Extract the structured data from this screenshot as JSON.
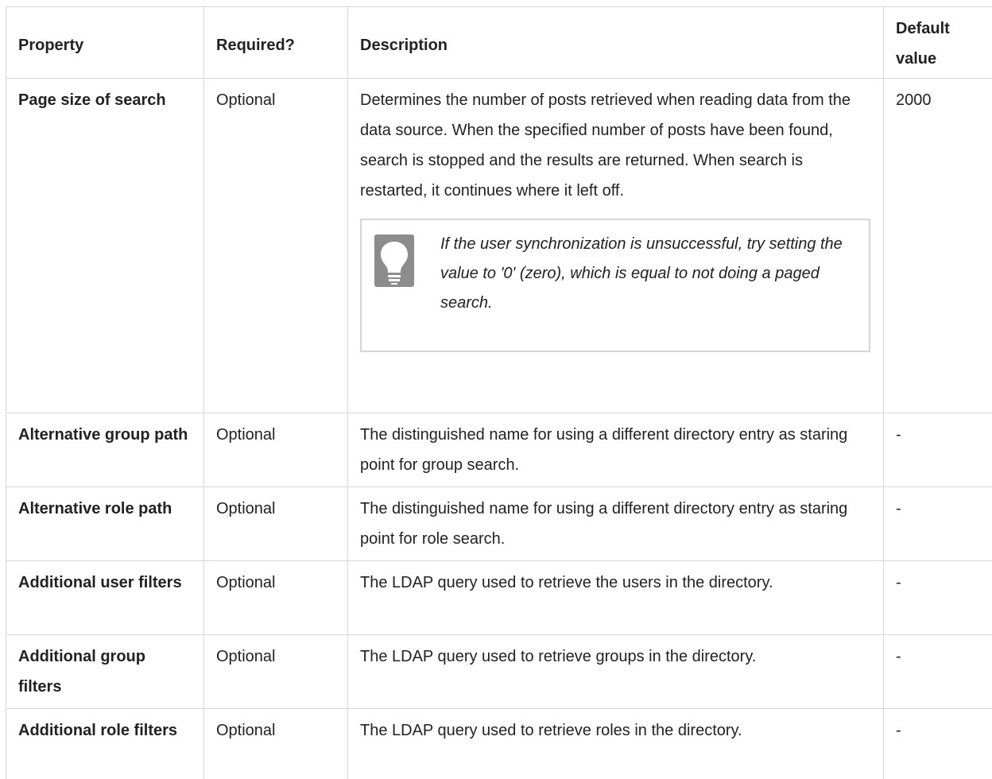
{
  "table": {
    "headers": {
      "property": "Property",
      "required": "Required?",
      "description": "Description",
      "default_line1": "Default",
      "default_line2": "value"
    },
    "rows": [
      {
        "property": "Page size of search",
        "required": "Optional",
        "description": "Determines the number of posts retrieved when reading data from the data source. When the specified number of posts have been found, search is stopped and the results are returned. When search is restarted, it continues where it left off.",
        "tip": "If the user synchronization is unsuccessful, try setting the value to '0' (zero), which is equal to not doing a paged search.",
        "tip_icon": "lightbulb-icon",
        "default": "2000"
      },
      {
        "property": "Alternative group path",
        "required": "Optional",
        "description": "The distinguished name for using a different directory entry as staring point for group search.",
        "default": "-"
      },
      {
        "property": "Alternative role path",
        "required": "Optional",
        "description": "The distinguished name for using a different directory entry as staring point for role search.",
        "default": "-"
      },
      {
        "property": "Additional user filters",
        "required": "Optional",
        "description": "The LDAP query used to retrieve the users in the directory.",
        "default": "-"
      },
      {
        "property": "Additional group filters",
        "required": "Optional",
        "description": "The LDAP query used to retrieve groups in the directory.",
        "default": "-"
      },
      {
        "property": "Additional role filters",
        "required": "Optional",
        "description": "The LDAP query used to retrieve roles in the directory.",
        "default": "-"
      }
    ]
  }
}
